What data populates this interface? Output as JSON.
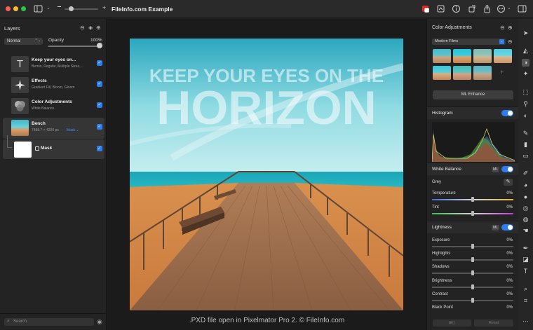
{
  "window": {
    "title": "FileInfo.com Example"
  },
  "layers_panel": {
    "title": "Layers",
    "blend_mode": "Normal",
    "opacity_label": "Opacity",
    "opacity_value": "100%",
    "opacity_fraction": 1.0,
    "layers": [
      {
        "name": "Keep your eyes on...",
        "sub": "Bernio, Regular, Multiple Sizes,...",
        "thumb": "T"
      },
      {
        "name": "Effects",
        "sub": "Gradient Fill, Bloom, Gloom",
        "thumb": ""
      },
      {
        "name": "Color Adjustments",
        "sub": "White Balance",
        "thumb": ""
      },
      {
        "name": "Bench",
        "sub": "7488.7 × 4200 px",
        "sub2": "Mask ⌄",
        "thumb": ""
      },
      {
        "name": "Mask",
        "sub": "",
        "thumb": ""
      }
    ],
    "search_placeholder": "Search"
  },
  "canvas": {
    "headline_line1": "KEEP YOUR EYES ON THE",
    "headline_line2": "HORIZON",
    "caption": ".PXD file open in Pixelmator Pro 2. © FileInfo.com"
  },
  "color_adjustments": {
    "title": "Color Adjustments",
    "preset": "Modern Films",
    "ml_enhance": "ML Enhance",
    "histogram": "Histogram",
    "white_balance": {
      "title": "White Balance",
      "ml": "ML",
      "grey": "Grey",
      "rows": [
        {
          "label": "Temperature",
          "value": "0%"
        },
        {
          "label": "Tint",
          "value": "0%"
        }
      ]
    },
    "lightness": {
      "title": "Lightness",
      "ml": "ML",
      "rows": [
        {
          "label": "Exposure",
          "value": "0%"
        },
        {
          "label": "Highlights",
          "value": "0%"
        },
        {
          "label": "Shadows",
          "value": "0%"
        },
        {
          "label": "Brightness",
          "value": "0%"
        },
        {
          "label": "Contrast",
          "value": "0%"
        },
        {
          "label": "Black Point",
          "value": "0%"
        }
      ]
    },
    "reset": "Reset"
  },
  "colors": {
    "accent": "#2d7cf0",
    "close": "#ff5f57",
    "minimize": "#febc2e",
    "maximize": "#28c840"
  }
}
